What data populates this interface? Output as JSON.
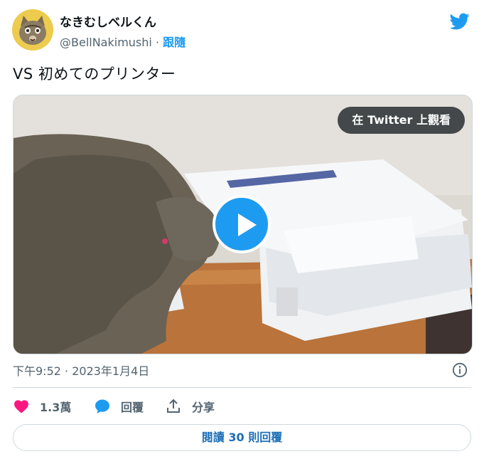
{
  "user": {
    "display_name": "なきむしベルくん",
    "handle": "@BellNakimushi",
    "separator": " · ",
    "follow_label": "跟隨"
  },
  "tweet": {
    "text": "VS 初めてのプリンター"
  },
  "media": {
    "watch_on_twitter_label": "在 Twitter 上觀看"
  },
  "meta": {
    "time": "下午9:52",
    "separator": " · ",
    "date": "2023年1月4日"
  },
  "actions": {
    "like_count": "1.3萬",
    "reply_label": "回覆",
    "share_label": "分享"
  },
  "read_replies_label": "閱讀 30 則回覆",
  "colors": {
    "accent": "#1d9bf0",
    "like": "#f91880",
    "text_secondary": "#536471"
  },
  "icons": [
    "twitter-bird-icon",
    "info-icon",
    "heart-icon",
    "reply-bubble-icon",
    "share-icon",
    "play-icon"
  ]
}
